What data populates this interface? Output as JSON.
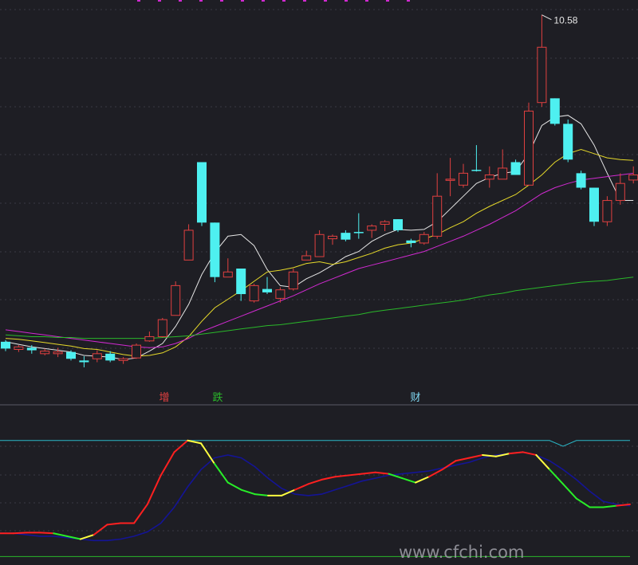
{
  "chart_data": [
    {
      "type": "candlestick",
      "annotations": {
        "high_label": "10.58"
      },
      "candles": [
        {
          "o": 6.74,
          "h": 6.76,
          "l": 6.63,
          "c": 6.66,
          "up": false
        },
        {
          "o": 6.68,
          "h": 6.7,
          "l": 6.62,
          "c": 6.65,
          "up": true
        },
        {
          "o": 6.67,
          "h": 6.7,
          "l": 6.6,
          "c": 6.64,
          "up": false
        },
        {
          "o": 6.6,
          "h": 6.66,
          "l": 6.58,
          "c": 6.63,
          "up": true
        },
        {
          "o": 6.6,
          "h": 6.67,
          "l": 6.56,
          "c": 6.62,
          "up": true
        },
        {
          "o": 6.62,
          "h": 6.64,
          "l": 6.52,
          "c": 6.54,
          "up": false
        },
        {
          "o": 6.52,
          "h": 6.57,
          "l": 6.44,
          "c": 6.5,
          "up": false
        },
        {
          "o": 6.54,
          "h": 6.64,
          "l": 6.5,
          "c": 6.6,
          "up": true
        },
        {
          "o": 6.6,
          "h": 6.63,
          "l": 6.5,
          "c": 6.52,
          "up": false
        },
        {
          "o": 6.52,
          "h": 6.56,
          "l": 6.48,
          "c": 6.54,
          "up": true
        },
        {
          "o": 6.55,
          "h": 6.72,
          "l": 6.54,
          "c": 6.7,
          "up": true
        },
        {
          "o": 6.75,
          "h": 6.86,
          "l": 6.74,
          "c": 6.8,
          "up": true
        },
        {
          "o": 6.8,
          "h": 7.02,
          "l": 6.79,
          "c": 7.0,
          "up": true
        },
        {
          "o": 7.05,
          "h": 7.45,
          "l": 7.05,
          "c": 7.4,
          "up": true
        },
        {
          "o": 7.7,
          "h": 8.12,
          "l": 7.7,
          "c": 8.05,
          "up": true
        },
        {
          "o": 8.85,
          "h": 8.85,
          "l": 8.1,
          "c": 8.14,
          "up": false
        },
        {
          "o": 8.14,
          "h": 8.14,
          "l": 7.44,
          "c": 7.5,
          "up": false
        },
        {
          "o": 7.5,
          "h": 7.72,
          "l": 7.5,
          "c": 7.56,
          "up": true
        },
        {
          "o": 7.6,
          "h": 7.6,
          "l": 7.22,
          "c": 7.3,
          "up": false
        },
        {
          "o": 7.22,
          "h": 7.42,
          "l": 7.2,
          "c": 7.4,
          "up": true
        },
        {
          "o": 7.36,
          "h": 7.5,
          "l": 7.3,
          "c": 7.32,
          "up": false
        },
        {
          "o": 7.25,
          "h": 7.38,
          "l": 7.2,
          "c": 7.35,
          "up": true
        },
        {
          "o": 7.36,
          "h": 7.6,
          "l": 7.34,
          "c": 7.56,
          "up": true
        },
        {
          "o": 7.7,
          "h": 7.81,
          "l": 7.7,
          "c": 7.75,
          "up": true
        },
        {
          "o": 7.74,
          "h": 8.05,
          "l": 7.74,
          "c": 8.0,
          "up": true
        },
        {
          "o": 7.95,
          "h": 8.0,
          "l": 7.88,
          "c": 7.98,
          "up": true
        },
        {
          "o": 8.02,
          "h": 8.05,
          "l": 7.92,
          "c": 7.94,
          "up": false
        },
        {
          "o": 8.03,
          "h": 8.25,
          "l": 7.95,
          "c": 8.02,
          "up": false
        },
        {
          "o": 8.05,
          "h": 8.12,
          "l": 7.96,
          "c": 8.1,
          "up": true
        },
        {
          "o": 8.12,
          "h": 8.17,
          "l": 8.04,
          "c": 8.15,
          "up": true
        },
        {
          "o": 8.18,
          "h": 8.18,
          "l": 8.03,
          "c": 8.05,
          "up": false
        },
        {
          "o": 7.9,
          "h": 7.95,
          "l": 7.85,
          "c": 7.93,
          "up": false
        },
        {
          "o": 7.9,
          "h": 8.03,
          "l": 7.88,
          "c": 8.0,
          "up": true
        },
        {
          "o": 7.98,
          "h": 8.72,
          "l": 7.95,
          "c": 8.45,
          "up": true
        },
        {
          "o": 8.65,
          "h": 8.9,
          "l": 8.45,
          "c": 8.65,
          "up": true
        },
        {
          "o": 8.58,
          "h": 8.83,
          "l": 8.55,
          "c": 8.72,
          "up": true
        },
        {
          "o": 8.75,
          "h": 9.05,
          "l": 8.74,
          "c": 8.76,
          "up": false
        },
        {
          "o": 8.7,
          "h": 8.8,
          "l": 8.55,
          "c": 8.65,
          "up": true
        },
        {
          "o": 8.65,
          "h": 9.0,
          "l": 8.65,
          "c": 8.78,
          "up": true
        },
        {
          "o": 8.85,
          "h": 8.88,
          "l": 8.7,
          "c": 8.7,
          "up": false
        },
        {
          "o": 8.58,
          "h": 9.55,
          "l": 8.58,
          "c": 9.45,
          "up": true
        },
        {
          "o": 9.55,
          "h": 10.58,
          "l": 9.5,
          "c": 10.2,
          "up": true
        },
        {
          "o": 9.6,
          "h": 9.6,
          "l": 9.28,
          "c": 9.3,
          "up": false
        },
        {
          "o": 9.3,
          "h": 9.35,
          "l": 8.85,
          "c": 8.88,
          "up": false
        },
        {
          "o": 8.72,
          "h": 8.75,
          "l": 8.53,
          "c": 8.55,
          "up": false
        },
        {
          "o": 8.55,
          "h": 8.55,
          "l": 8.1,
          "c": 8.15,
          "up": false
        },
        {
          "o": 8.15,
          "h": 8.45,
          "l": 8.1,
          "c": 8.4,
          "up": true
        },
        {
          "o": 8.4,
          "h": 8.72,
          "l": 8.35,
          "c": 8.6,
          "up": true
        },
        {
          "o": 8.64,
          "h": 8.8,
          "l": 8.6,
          "c": 8.7,
          "up": true
        }
      ],
      "ma": [
        {
          "color": "#e6e6e6",
          "values": [
            6.74,
            6.71,
            6.68,
            6.66,
            6.64,
            6.62,
            6.58,
            6.57,
            6.56,
            6.53,
            6.55,
            6.63,
            6.72,
            6.92,
            7.18,
            7.53,
            7.79,
            7.98,
            8.0,
            7.87,
            7.59,
            7.4,
            7.38,
            7.48,
            7.55,
            7.64,
            7.74,
            7.8,
            7.92,
            8.0,
            8.06,
            8.05,
            8.06,
            8.15,
            8.3,
            8.45,
            8.6,
            8.67,
            8.72,
            8.74,
            8.95,
            9.28,
            9.38,
            9.4,
            9.3,
            9.05,
            8.72,
            8.4,
            8.4
          ]
        },
        {
          "color": "#e6d92a",
          "values": [
            6.78,
            6.77,
            6.75,
            6.73,
            6.71,
            6.69,
            6.66,
            6.65,
            6.62,
            6.59,
            6.57,
            6.58,
            6.61,
            6.68,
            6.8,
            6.98,
            7.14,
            7.24,
            7.34,
            7.45,
            7.56,
            7.58,
            7.61,
            7.66,
            7.68,
            7.65,
            7.68,
            7.73,
            7.78,
            7.84,
            7.88,
            7.9,
            7.95,
            8.0,
            8.08,
            8.15,
            8.25,
            8.33,
            8.4,
            8.47,
            8.58,
            8.7,
            8.85,
            8.95,
            9.0,
            8.95,
            8.9,
            8.88,
            8.87
          ]
        },
        {
          "color": "#d12ad1",
          "values": [
            6.88,
            6.86,
            6.84,
            6.82,
            6.8,
            6.78,
            6.76,
            6.74,
            6.72,
            6.7,
            6.68,
            6.67,
            6.68,
            6.72,
            6.78,
            6.86,
            6.92,
            6.98,
            7.04,
            7.1,
            7.16,
            7.22,
            7.28,
            7.35,
            7.42,
            7.48,
            7.54,
            7.6,
            7.64,
            7.68,
            7.72,
            7.76,
            7.8,
            7.86,
            7.92,
            7.98,
            8.05,
            8.12,
            8.2,
            8.28,
            8.38,
            8.48,
            8.55,
            8.6,
            8.64,
            8.66,
            8.68,
            8.7,
            8.72
          ]
        },
        {
          "color": "#2ab82a",
          "values": [
            6.82,
            6.81,
            6.8,
            6.8,
            6.79,
            6.79,
            6.78,
            6.78,
            6.78,
            6.78,
            6.78,
            6.78,
            6.79,
            6.8,
            6.81,
            6.83,
            6.85,
            6.87,
            6.89,
            6.91,
            6.93,
            6.94,
            6.96,
            6.98,
            7.0,
            7.02,
            7.04,
            7.06,
            7.09,
            7.11,
            7.13,
            7.15,
            7.17,
            7.19,
            7.21,
            7.23,
            7.26,
            7.29,
            7.31,
            7.34,
            7.36,
            7.38,
            7.4,
            7.42,
            7.44,
            7.45,
            7.46,
            7.48,
            7.5
          ]
        }
      ],
      "ylim": [
        6.28,
        10.68
      ]
    },
    {
      "type": "line",
      "labels": [
        "增",
        "跌",
        "财"
      ],
      "ylim": [
        0,
        100
      ],
      "series": [
        {
          "values": [
            18,
            18,
            18.5,
            18.5,
            18,
            16,
            14,
            17,
            24,
            25,
            25,
            38,
            58,
            74,
            82,
            80,
            66,
            53,
            48,
            45,
            44,
            44,
            48,
            52,
            55,
            57,
            58,
            59,
            60,
            59,
            56,
            53,
            57,
            62,
            68,
            70,
            72,
            71,
            73,
            74,
            72,
            62,
            52,
            42,
            36,
            36,
            37,
            38
          ],
          "colors": [
            "red",
            "red",
            "red",
            "red",
            "green",
            "green",
            "yellow",
            "red",
            "red",
            "red",
            "red",
            "red",
            "red",
            "red",
            "yellow",
            "yellow",
            "green",
            "green",
            "green",
            "green",
            "yellow",
            "yellow",
            "red",
            "red",
            "red",
            "red",
            "red",
            "red",
            "red",
            "green",
            "green",
            "yellow",
            "red",
            "red",
            "red",
            "red",
            "yellow",
            "yellow",
            "red",
            "red",
            "yellow",
            "green",
            "green",
            "green",
            "green",
            "green",
            "red"
          ]
        },
        {
          "color": "#141496",
          "values": [
            18,
            18,
            17,
            16,
            16,
            15,
            14,
            13,
            13,
            14,
            16,
            19,
            25,
            36,
            50,
            62,
            70,
            72,
            70,
            64,
            56,
            49,
            45,
            44,
            45,
            48,
            51,
            54,
            56,
            58,
            59,
            60,
            61,
            63,
            65,
            67,
            70,
            72,
            73,
            74,
            72,
            68,
            62,
            55,
            47,
            40,
            38,
            37
          ]
        },
        {
          "color": "#2ab8c8",
          "values": [
            82,
            82,
            82,
            82,
            82,
            82,
            82,
            82,
            82,
            82,
            82,
            82,
            82,
            82,
            82,
            82,
            82,
            82,
            82,
            82,
            82,
            82,
            82,
            82,
            82,
            82,
            82,
            82,
            82,
            82,
            82,
            82,
            82,
            82,
            82,
            82,
            82,
            82,
            82,
            82,
            82,
            82,
            78,
            82,
            82,
            82,
            82,
            82
          ]
        },
        {
          "color": "#2ab82a",
          "values": [
            2,
            2,
            2,
            2,
            2,
            2,
            2,
            2,
            2,
            2,
            2,
            2,
            2,
            2,
            2,
            2,
            2,
            2,
            2,
            2,
            2,
            2,
            2,
            2,
            2,
            2,
            2,
            2,
            2,
            2,
            2,
            2,
            2,
            2,
            2,
            2,
            2,
            2,
            2,
            2,
            2,
            2,
            2,
            2,
            2,
            2,
            2,
            2
          ]
        }
      ]
    }
  ],
  "watermark": "www.cfchi.com"
}
